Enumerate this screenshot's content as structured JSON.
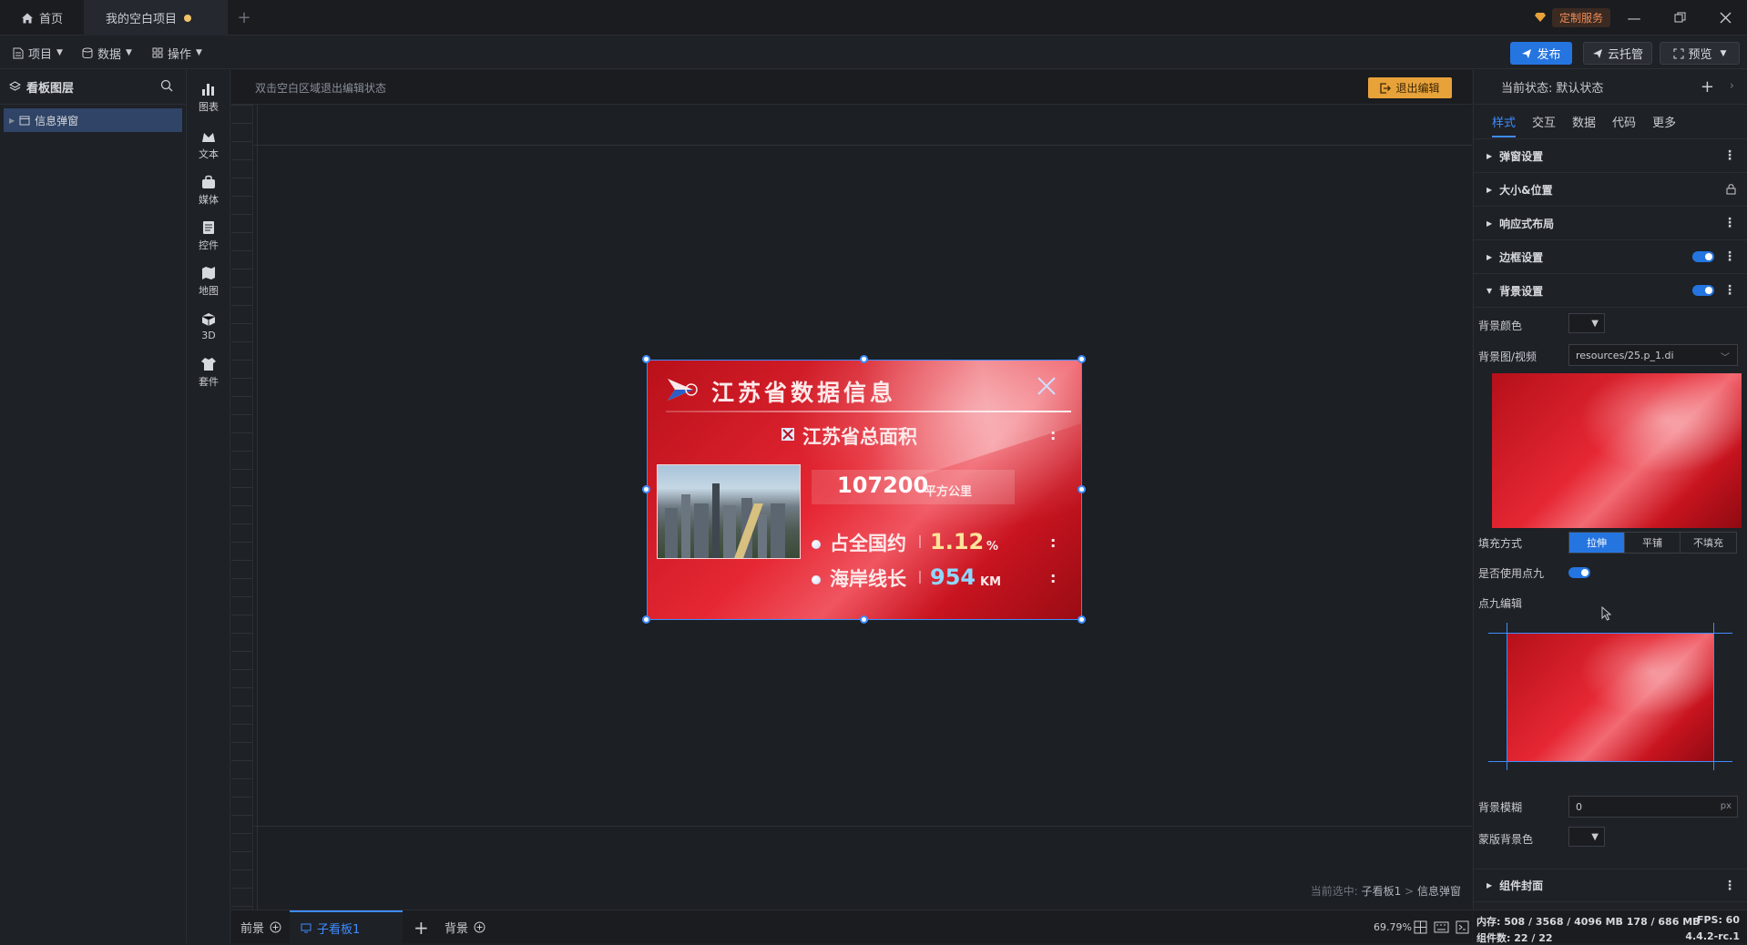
{
  "titlebar": {
    "home_tab": "首页",
    "project_tab": "我的空白项目",
    "custom_service": "定制服务"
  },
  "menubar": {
    "project": "项目",
    "data": "数据",
    "operate": "操作",
    "publish": "发布",
    "cloud": "云托管",
    "preview": "预览"
  },
  "layers": {
    "title": "看板图层",
    "items": [
      {
        "label": "信息弹窗"
      }
    ]
  },
  "toolbox": [
    {
      "label": "图表",
      "icon": "chart-icon"
    },
    {
      "label": "文本",
      "icon": "text-icon"
    },
    {
      "label": "媒体",
      "icon": "media-icon"
    },
    {
      "label": "控件",
      "icon": "control-icon"
    },
    {
      "label": "地图",
      "icon": "map-icon"
    },
    {
      "label": "3D",
      "icon": "cube-icon"
    },
    {
      "label": "套件",
      "icon": "suite-icon"
    }
  ],
  "canvas": {
    "hint": "双击空白区域退出编辑状态",
    "exit_button": "退出编辑",
    "selected_prefix": "当前选中:",
    "selected_path_parent": "子看板1",
    "selected_path_sep": ">",
    "selected_path_item": "信息弹窗"
  },
  "popup": {
    "title": "江苏省数据信息",
    "area_label": "江苏省总面积",
    "area_value": "107200",
    "area_unit": "平方公里",
    "share_label": "占全国约",
    "share_value": "1.12",
    "share_unit": "%",
    "coast_label": "海岸线长",
    "coast_value": "954",
    "coast_unit": "KM"
  },
  "bottom_tabs": {
    "front": "前景",
    "sub_board": "子看板1",
    "background": "背景",
    "zoom": "69.79%"
  },
  "props": {
    "state_label": "当前状态:",
    "state_value": "默认状态",
    "tabs": [
      "样式",
      "交互",
      "数据",
      "代码",
      "更多"
    ],
    "sections": {
      "popup_settings": "弹窗设置",
      "size_position": "大小&位置",
      "responsive": "响应式布局",
      "border": "边框设置",
      "background": "背景设置",
      "cover": "组件封面"
    },
    "bg_color_label": "背景颜色",
    "bg_image_label": "背景图/视频",
    "bg_image_value": "resources/25.p_1.di",
    "fill_mode_label": "填充方式",
    "fill_modes": [
      "拉伸",
      "平铺",
      "不填充"
    ],
    "fill_mode_active": "拉伸",
    "use_nine_label": "是否使用点九",
    "nine_edit_label": "点九编辑",
    "blur_label": "背景模糊",
    "blur_value": "0",
    "blur_unit": "px",
    "mask_color_label": "蒙版背景色"
  },
  "status": {
    "memory": "内存: 508 / 3568 / 4096 MB 178 / 686 MB",
    "fps": "FPS: 60",
    "components": "组件数: 22 / 22",
    "version": "4.4.2-rc.1"
  },
  "colors": {
    "accent": "#2575e0",
    "exit_button": "#e8a23a",
    "popup_red": "#e52733",
    "gold_value": "#ffe49a",
    "cyan_value": "#8fd7ff"
  }
}
